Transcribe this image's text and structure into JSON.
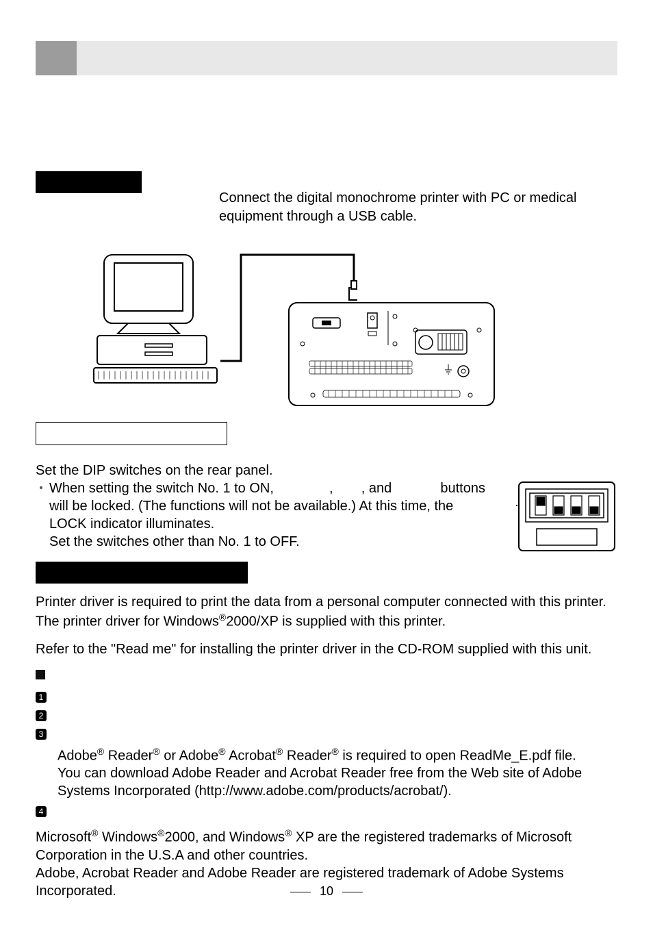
{
  "intro": {
    "line1": "Connect the digital monochrome printer with PC or medical",
    "line2": "equipment through a USB cable."
  },
  "dip": {
    "lead": "Set the DIP switches on the rear panel.",
    "b1a": "When setting the switch No. 1 to ON,",
    "b1b": ",",
    "b1c": ", and",
    "b1d": "buttons",
    "b2": "will be locked. (The functions will not be available.)  At this time, the",
    "b3": "LOCK indicator illuminates.",
    "b4": "Set the switches other than No. 1 to OFF."
  },
  "driver": {
    "p1": "Printer driver is required to print the data from a personal computer connected with this printer.",
    "p2a": "The printer driver for Windows",
    "p2b": "2000/XP is supplied with this printer.",
    "p3": "Refer to the \"Read me\" for installing the printer driver in the CD-ROM supplied with this unit.",
    "p4a": "Adobe",
    "p4b": " Reader",
    "p4c": " or Adobe",
    "p4d": " Acrobat",
    "p4e": " Reader",
    "p4f": " is required to open ReadMe_E.pdf file.",
    "p5": "You can download Adobe Reader and Acrobat Reader free from the Web site of Adobe",
    "p6": "Systems Incorporated (http://www.adobe.com/products/acrobat/).",
    "p7a": "Microsoft",
    "p7b": " Windows",
    "p7c": "2000, and Windows",
    "p7d": " XP are the registered trademarks of Microsoft",
    "p8": "Corporation in the U.S.A and other countries.",
    "p9": "Adobe, Acrobat Reader and Adobe Reader are registered trademark of Adobe Systems",
    "p10": "Incorporated."
  },
  "reg": "®",
  "page_number": "10",
  "nums": {
    "n1": "1",
    "n2": "2",
    "n3": "3",
    "n4": "4"
  }
}
